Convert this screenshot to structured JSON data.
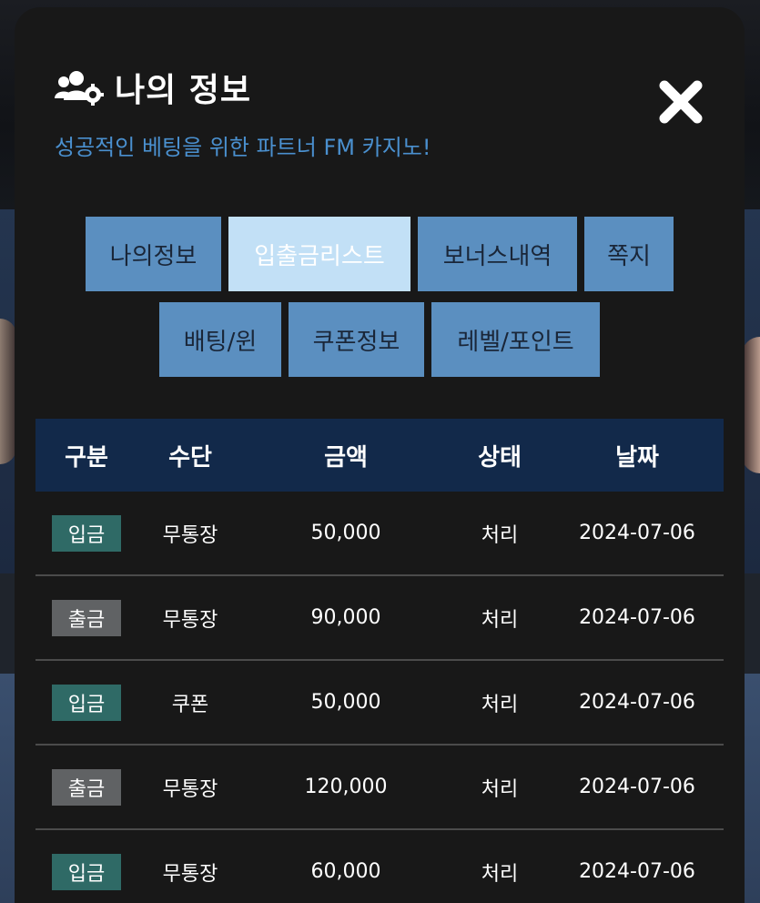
{
  "modal": {
    "title": "나의 정보",
    "subtitle": "성공적인 베팅을 위한 파트너 FM 카지노!",
    "title_icon": "users-gear-icon",
    "close_icon": "close-icon"
  },
  "tabs": [
    {
      "label": "나의정보",
      "active": false
    },
    {
      "label": "입출금리스트",
      "active": true
    },
    {
      "label": "보너스내역",
      "active": false
    },
    {
      "label": "쪽지",
      "active": false
    },
    {
      "label": "배팅/윈",
      "active": false
    },
    {
      "label": "쿠폰정보",
      "active": false
    },
    {
      "label": "레벨/포인트",
      "active": false
    }
  ],
  "table": {
    "headers": [
      "구분",
      "수단",
      "금액",
      "상태",
      "날짜"
    ],
    "rows": [
      {
        "type": "입금",
        "method": "무통장",
        "amount": "50,000",
        "status": "처리",
        "date": "2024-07-06"
      },
      {
        "type": "출금",
        "method": "무통장",
        "amount": "90,000",
        "status": "처리",
        "date": "2024-07-06"
      },
      {
        "type": "입금",
        "method": "쿠폰",
        "amount": "50,000",
        "status": "처리",
        "date": "2024-07-06"
      },
      {
        "type": "출금",
        "method": "무통장",
        "amount": "120,000",
        "status": "처리",
        "date": "2024-07-06"
      },
      {
        "type": "입금",
        "method": "무통장",
        "amount": "60,000",
        "status": "처리",
        "date": "2024-07-06"
      }
    ]
  },
  "colors": {
    "modal_bg": "#181818",
    "subtitle": "#4a90cf",
    "tab": "#5b8fc0",
    "tab_active": "#c2e0f6",
    "table_header": "#12294a",
    "deposit_badge": "#2f6a66",
    "withdraw_badge": "#606264"
  }
}
